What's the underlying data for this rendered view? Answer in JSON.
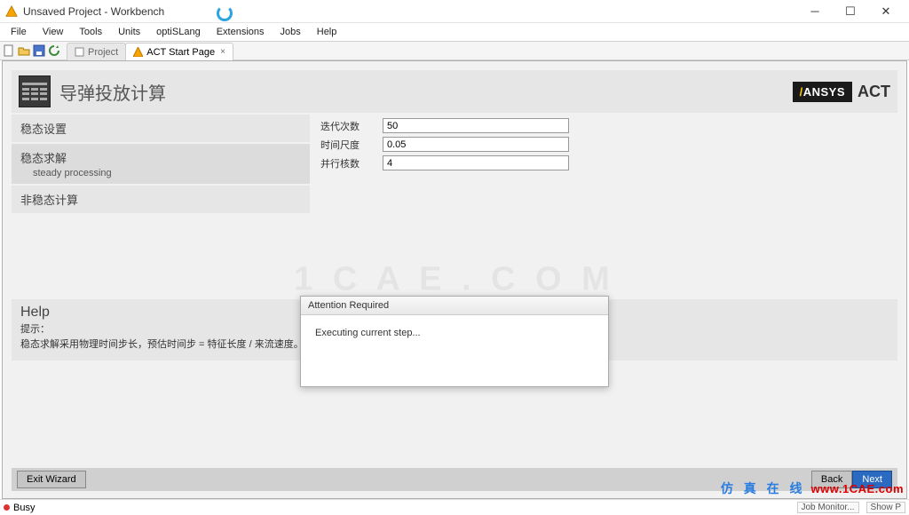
{
  "window": {
    "title": "Unsaved Project - Workbench"
  },
  "menu": {
    "items": [
      "File",
      "View",
      "Tools",
      "Units",
      "optiSLang",
      "Extensions",
      "Jobs",
      "Help"
    ]
  },
  "tabs": {
    "project": {
      "label": "Project"
    },
    "act": {
      "label": "ACT Start Page"
    }
  },
  "header": {
    "title": "导弹投放计算",
    "brand_ansys": "ANSYS",
    "brand_act": "ACT"
  },
  "sidebar": {
    "items": [
      {
        "label": "稳态设置"
      },
      {
        "label": "稳态求解",
        "sub": "steady processing"
      },
      {
        "label": "非稳态计算"
      }
    ]
  },
  "form": {
    "iter": {
      "label": "迭代次数",
      "value": "50"
    },
    "timescale": {
      "label": "时间尺度",
      "value": "0.05"
    },
    "cores": {
      "label": "并行核数",
      "value": "4"
    }
  },
  "help": {
    "title": "Help",
    "line1": "提示：",
    "line2": "稳态求解采用物理时间步长，预估时间步 = 特征长度 / 来流速度。"
  },
  "footer": {
    "exit": "Exit Wizard",
    "back": "Back",
    "next": "Next"
  },
  "modal": {
    "title": "Attention Required",
    "body": "Executing current step..."
  },
  "status": {
    "text": "Busy",
    "job": "Job Monitor...",
    "show": "Show P"
  },
  "watermark": {
    "center": "1 C A E . C O M",
    "cn": "仿 真 在 线",
    "url": "www.1CAE.com"
  }
}
